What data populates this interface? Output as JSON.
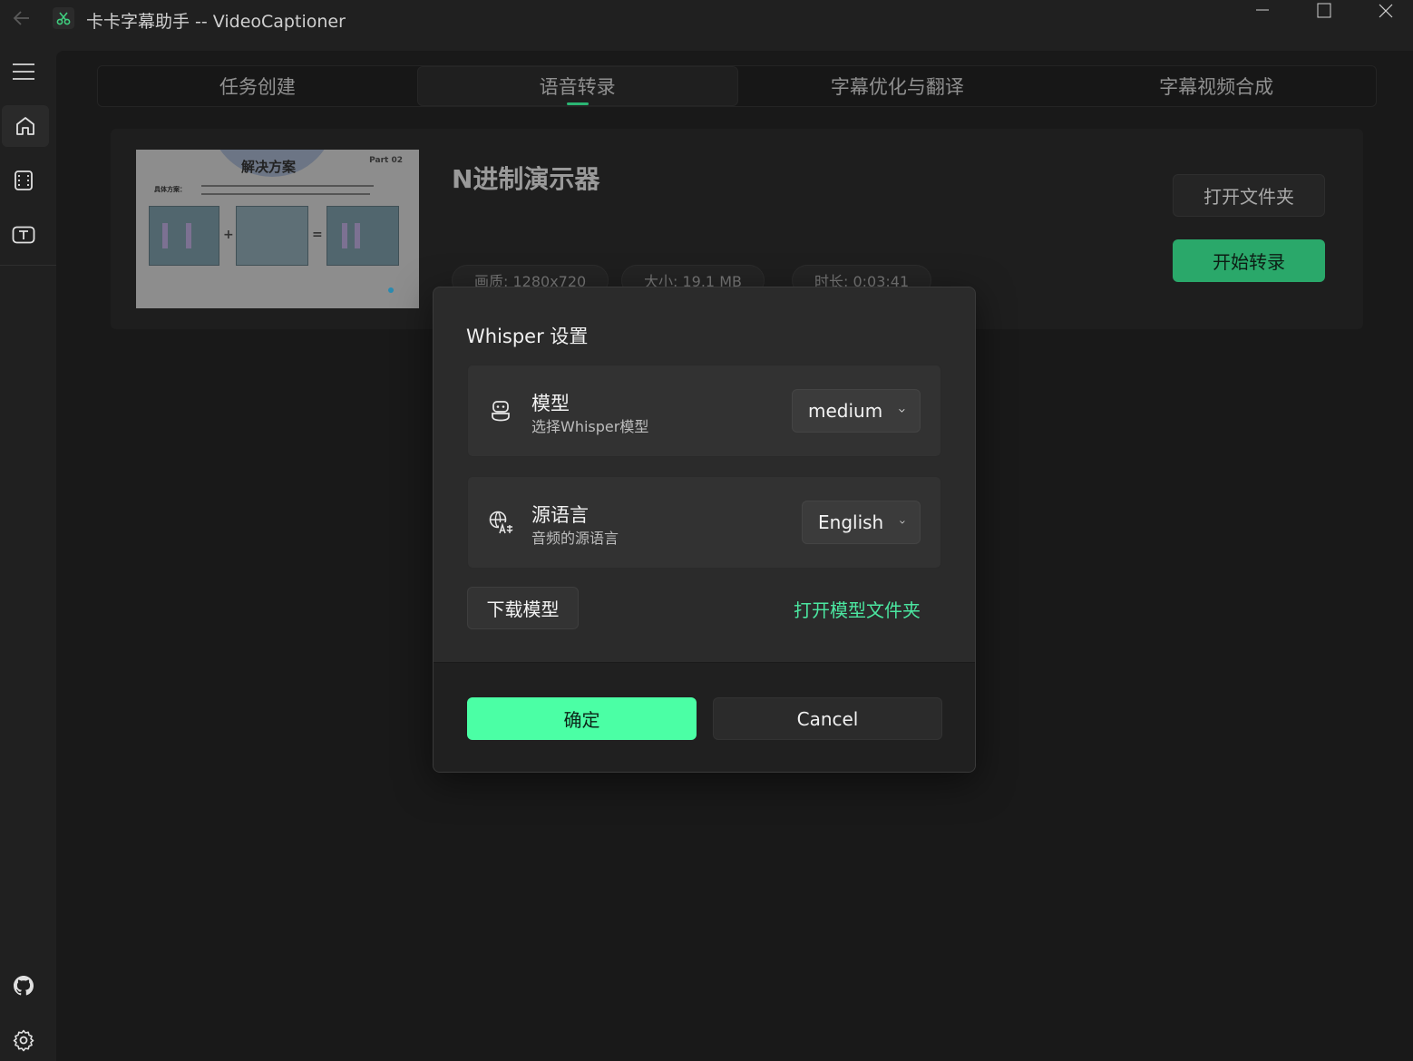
{
  "window": {
    "title": "卡卡字幕助手 -- VideoCaptioner"
  },
  "tabs": [
    {
      "label": "任务创建",
      "active": false
    },
    {
      "label": "语音转录",
      "active": true
    },
    {
      "label": "字幕优化与翻译",
      "active": false
    },
    {
      "label": "字幕视频合成",
      "active": false
    }
  ],
  "sidebar": {
    "items": [
      {
        "icon": "menu-icon"
      },
      {
        "icon": "home-icon",
        "active": true
      },
      {
        "icon": "film-icon"
      },
      {
        "icon": "text-icon"
      },
      {
        "icon": "github-icon"
      },
      {
        "icon": "gear-icon"
      }
    ]
  },
  "video": {
    "title": "N进制演示器",
    "resolution": "画质: 1280x720",
    "size": "大小: 19.1 MB",
    "duration": "时长: 0:03:41",
    "open_folder_label": "打开文件夹",
    "start_label": "开始转录",
    "thumbnail": {
      "heading": "解决方案",
      "part": "Part 02",
      "sub": "具体方案："
    }
  },
  "dialog": {
    "title": "Whisper 设置",
    "model": {
      "label": "模型",
      "description": "选择Whisper模型",
      "value": "medium"
    },
    "language": {
      "label": "源语言",
      "description": "音频的源语言",
      "value": "English"
    },
    "download_label": "下载模型",
    "open_model_folder_label": "打开模型文件夹",
    "ok_label": "确定",
    "cancel_label": "Cancel"
  },
  "colors": {
    "accent": "#2bb673",
    "start_button": "#2aa86a",
    "ok_button": "#4bffa5",
    "link": "#4be6a0"
  }
}
